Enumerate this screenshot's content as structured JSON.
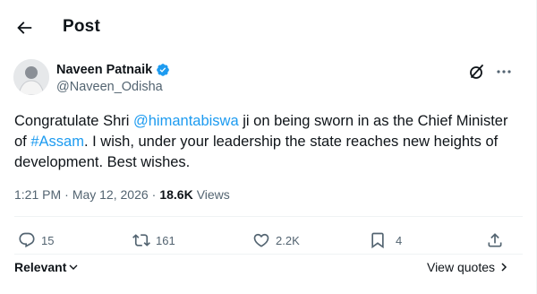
{
  "header": {
    "title": "Post"
  },
  "author": {
    "name": "Naveen Patnaik",
    "handle": "@Naveen_Odisha"
  },
  "tweet": {
    "t1": "Congratulate Shri ",
    "mention": "@himantabiswa",
    "t2": " ji on being sworn in as the Chief Minister of ",
    "hashtag": "#Assam",
    "t3": ". I wish, under your leadership the state reaches new heights of development. Best wishes."
  },
  "meta": {
    "time": "1:21 PM",
    "separator": "·",
    "date": "May 12, 2026",
    "views_count": "18.6K",
    "views_label": "Views"
  },
  "actions": {
    "replies": "15",
    "reposts": "161",
    "likes": "2.2K",
    "bookmarks": "4"
  },
  "sort": {
    "label": "Relevant"
  },
  "quotes": {
    "label": "View quotes"
  },
  "colors": {
    "link": "#1d9bf0",
    "verified": "#1d9bf0",
    "muted": "#536471",
    "text": "#0f1419"
  },
  "icons": [
    "back-arrow-icon",
    "verified-badge-icon",
    "grok-icon",
    "more-icon",
    "reply-icon",
    "repost-icon",
    "like-icon",
    "bookmark-icon",
    "share-icon",
    "chevron-down-icon",
    "chevron-right-icon"
  ]
}
